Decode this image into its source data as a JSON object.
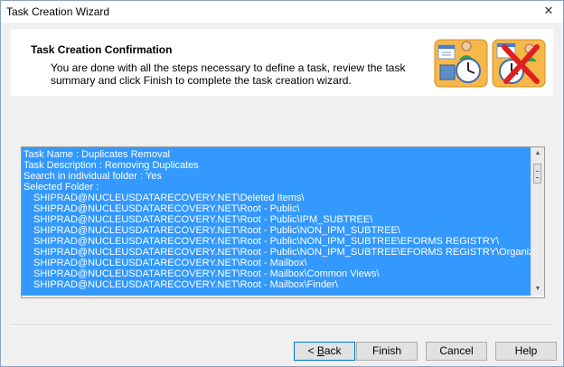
{
  "window": {
    "title": "Task Creation Wizard",
    "close_glyph": "✕"
  },
  "header": {
    "title": "Task Creation Confirmation",
    "description": "You are done with all the steps necessary to define a task, review the task summary and click Finish to complete the task creation wizard.",
    "icons": [
      "user-clock-calendar-icon",
      "clock-calendar-delete-icon"
    ]
  },
  "summary": {
    "lines": [
      "Task Name : Duplicates Removal",
      "Task Description : Removing Duplicates",
      "Search in individual folder : Yes",
      "Selected Folder :",
      "SHIPRAD@NUCLEUSDATARECOVERY.NET\\Deleted Items\\",
      "SHIPRAD@NUCLEUSDATARECOVERY.NET\\Root - Public\\",
      "SHIPRAD@NUCLEUSDATARECOVERY.NET\\Root - Public\\IPM_SUBTREE\\",
      "SHIPRAD@NUCLEUSDATARECOVERY.NET\\Root - Public\\NON_IPM_SUBTREE\\",
      "SHIPRAD@NUCLEUSDATARECOVERY.NET\\Root - Public\\NON_IPM_SUBTREE\\EFORMS REGISTRY\\",
      "SHIPRAD@NUCLEUSDATARECOVERY.NET\\Root - Public\\NON_IPM_SUBTREE\\EFORMS REGISTRY\\Organization Forms\\",
      "SHIPRAD@NUCLEUSDATARECOVERY.NET\\Root - Mailbox\\",
      "SHIPRAD@NUCLEUSDATARECOVERY.NET\\Root - Mailbox\\Common Views\\",
      "SHIPRAD@NUCLEUSDATARECOVERY.NET\\Root - Mailbox\\Finder\\"
    ],
    "selection_color": "#3399ff"
  },
  "buttons": {
    "back_prefix": "< ",
    "back_mnemonic": "B",
    "back_rest": "ack",
    "finish": "Finish",
    "cancel": "Cancel",
    "help": "Help"
  }
}
